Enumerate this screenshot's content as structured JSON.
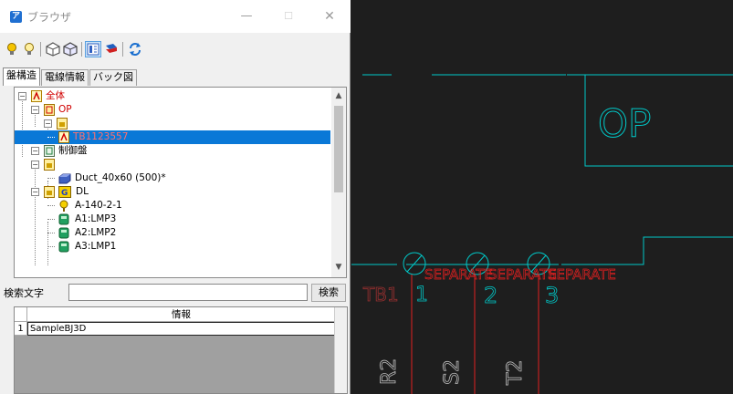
{
  "window": {
    "title": "ブラウザ",
    "app_icon": "ア"
  },
  "toolbar": {
    "icons": [
      "bulb-on-icon",
      "bulb-off-icon",
      "cube-icon",
      "cube-outline-icon",
      "panel-view-icon",
      "layers-icon",
      "refresh-icon"
    ]
  },
  "tabs": [
    {
      "label": "盤構造",
      "active": true
    },
    {
      "label": "電線情報",
      "active": false
    },
    {
      "label": "バック図",
      "active": false
    }
  ],
  "tree": [
    {
      "label": "全体",
      "color": "#d00000"
    },
    {
      "label": "OP",
      "color": "#d00000"
    },
    {
      "label": "",
      "color": "#000000"
    },
    {
      "label": "TB1123557",
      "color": "#e04040",
      "selected": true
    },
    {
      "label": "制御盤",
      "color": "#000000"
    },
    {
      "label": "",
      "color": "#000000"
    },
    {
      "label": "Duct_40x60 (500)*",
      "color": "#000000"
    },
    {
      "label": "DL",
      "color": "#000000"
    },
    {
      "label": "A-140-2-1",
      "color": "#000000"
    },
    {
      "label": "A1:LMP3",
      "color": "#000000"
    },
    {
      "label": "A2:LMP2",
      "color": "#000000"
    },
    {
      "label": "A3:LMP1",
      "color": "#000000"
    }
  ],
  "search": {
    "label": "検索文字",
    "value": "",
    "button": "検索"
  },
  "grid": {
    "header": "情報",
    "rows": [
      {
        "num": "1",
        "value": "SampleBJ3D"
      }
    ]
  },
  "cad": {
    "line_color": "#00c8c8",
    "wire_color": "#e02020",
    "op_label": "OP",
    "tb_label": "TB1",
    "terminals": [
      "1",
      "2",
      "3"
    ],
    "overlap_text": "SEPARATE",
    "wire_labels": [
      "R2",
      "S2",
      "T2"
    ]
  }
}
